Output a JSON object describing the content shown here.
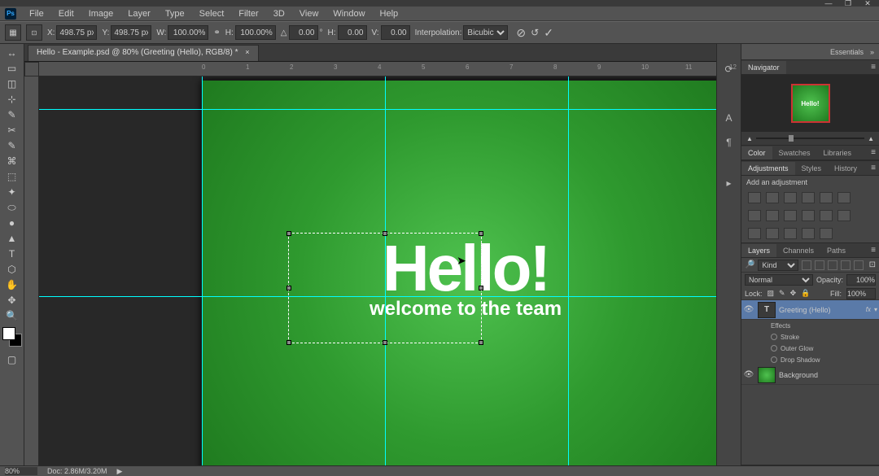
{
  "window": {
    "min": "—",
    "max": "❐",
    "close": "✕"
  },
  "menu": [
    "File",
    "Edit",
    "Image",
    "Layer",
    "Type",
    "Select",
    "Filter",
    "3D",
    "View",
    "Window",
    "Help"
  ],
  "options": {
    "x_lbl": "X:",
    "x": "498.75 px",
    "y_lbl": "Y:",
    "498.75 px": "498.75 px",
    "y": "498.75 px",
    "w_lbl": "W:",
    "w": "100.00%",
    "h_lbl": "H:",
    "h": "100.00%",
    "angle_lbl": "△",
    "angle": "0.00",
    "deg": "°",
    "skewh_lbl": "H:",
    "skewh": "0.00",
    "skewv_lbl": "V:",
    "skewv": "0.00",
    "interp_lbl": "Interpolation:",
    "interp": "Bicubic"
  },
  "doc_tab": "Hello - Example.psd @ 80% (Greeting (Hello), RGB/8) *",
  "ruler_marks": [
    "0",
    "1",
    "2",
    "3",
    "4",
    "5",
    "6",
    "7",
    "8",
    "9",
    "10",
    "11",
    "12"
  ],
  "canvas": {
    "hello": "Hello!",
    "welcome": "welcome to the team"
  },
  "essentials": "Essentials",
  "nav_tab": "Navigator",
  "nav_thumb": "Hello!",
  "color_tabs": [
    "Color",
    "Swatches",
    "Libraries"
  ],
  "adj_tabs": [
    "Adjustments",
    "Styles",
    "History"
  ],
  "adj_title": "Add an adjustment",
  "layers_tabs": [
    "Layers",
    "Channels",
    "Paths"
  ],
  "layer_filter": "Kind",
  "blend_mode": "Normal",
  "opacity_lbl": "Opacity:",
  "opacity": "100%",
  "lock_lbl": "Lock:",
  "fill_lbl": "Fill:",
  "fill": "100%",
  "layers": {
    "greeting": "Greeting (Hello)",
    "fx": "fx",
    "effects": "Effects",
    "stroke": "Stroke",
    "outerglow": "Outer Glow",
    "dropshadow": "Drop Shadow",
    "background": "Background"
  },
  "status": {
    "zoom": "80%",
    "doc": "Doc: 2.86M/3.20M",
    "play": "▶"
  },
  "tools_glyphs": [
    "↔",
    "▭",
    "◫",
    "⊹",
    "✎",
    "✂",
    "✎",
    "⌘",
    "⬚",
    "✦",
    "⬭",
    "●",
    "▲",
    "T",
    "⬡",
    "✋",
    "✥",
    "🔍"
  ]
}
